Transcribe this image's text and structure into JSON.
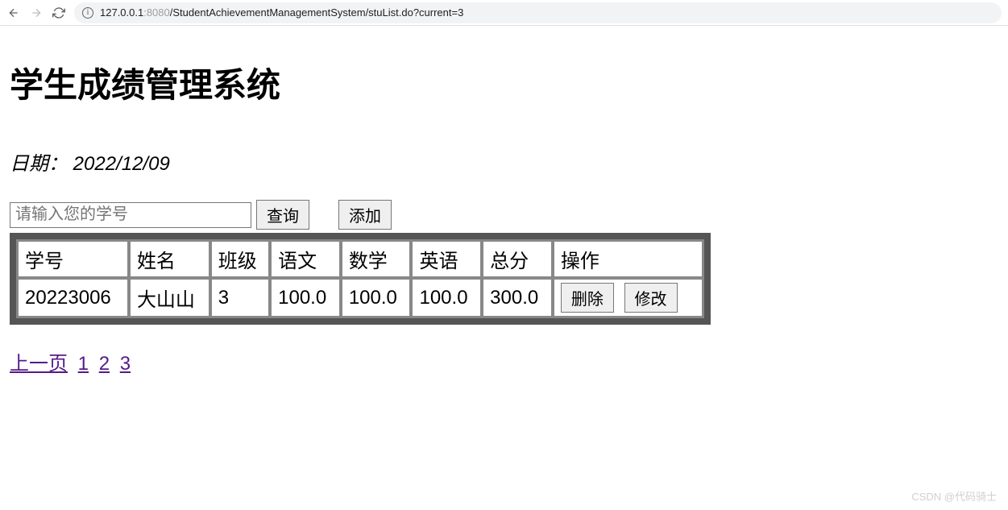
{
  "browser": {
    "url_host": "127.0.0.1",
    "url_port": ":8080",
    "url_path": "/StudentAchievementManagementSystem/stuList.do?current=3"
  },
  "page": {
    "title": "学生成绩管理系统",
    "date_label": "日期：",
    "date_value": "2022/12/09"
  },
  "controls": {
    "search_placeholder": "请输入您的学号",
    "search_label": "查询",
    "add_label": "添加"
  },
  "table": {
    "headers": [
      "学号",
      "姓名",
      "班级",
      "语文",
      "数学",
      "英语",
      "总分",
      "操作"
    ],
    "rows": [
      {
        "id": "20223006",
        "name": "大山山",
        "class": "3",
        "chinese": "100.0",
        "math": "100.0",
        "english": "100.0",
        "total": "300.0"
      }
    ],
    "delete_label": "删除",
    "edit_label": "修改"
  },
  "pagination": {
    "prev_label": "上一页",
    "pages": [
      "1",
      "2",
      "3"
    ]
  },
  "watermark": "CSDN @代码骑士"
}
